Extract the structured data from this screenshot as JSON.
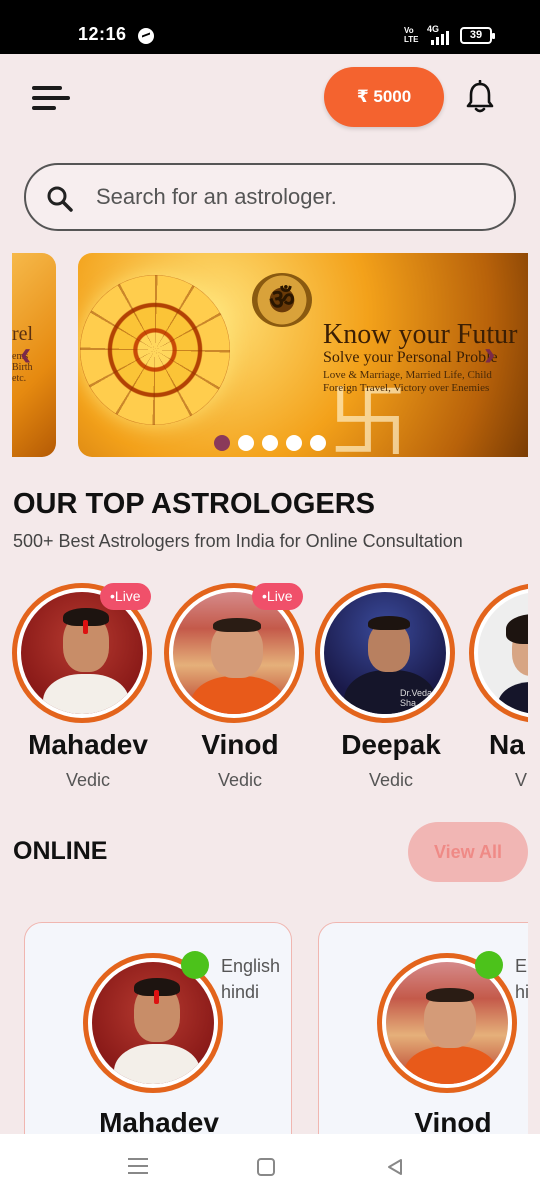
{
  "status_bar": {
    "time": "12:16",
    "volte": "Vo LTE",
    "network": "4G",
    "battery": "39"
  },
  "header": {
    "wallet_label": "₹ 5000"
  },
  "search": {
    "placeholder": "Search for an astrologer."
  },
  "banner": {
    "prev_slide_text": "rel",
    "prev_slide_subtext": "ems\nBirth\netc.",
    "om": "ॐ",
    "title": "Know your Futur",
    "subtitle": "Solve your Personal Proble",
    "description_line1": "Love & Marriage, Married Life, Child",
    "description_line2": "Foreign Travel, Victory over Enemies",
    "dots_count": 5,
    "active_dot": 0
  },
  "top_astrologers": {
    "title": "OUR TOP ASTROLOGERS",
    "subtitle": "500+ Best Astrologers from India for Online Consultation",
    "items": [
      {
        "name": "Mahadev",
        "type": "Vedic",
        "live": true,
        "live_label": "•Live"
      },
      {
        "name": "Vinod",
        "type": "Vedic",
        "live": true,
        "live_label": "•Live"
      },
      {
        "name": "Deepak",
        "type": "Vedic",
        "live": false,
        "photo_caption": "Dr.Veda Sha"
      },
      {
        "name": "Na",
        "type": "V",
        "live": false
      }
    ]
  },
  "online": {
    "title": "ONLINE",
    "view_all_label": "View All",
    "cards": [
      {
        "name": "Mahadev",
        "lang1": "English",
        "lang2": "hindi"
      },
      {
        "name": "Vinod",
        "lang1": "En",
        "lang2": "hi"
      }
    ]
  },
  "colors": {
    "accent": "#f4632f",
    "live_badge": "#f0506a",
    "ring": "#e3641c",
    "online_dot": "#4cc21b",
    "background": "#f4e9ea"
  }
}
